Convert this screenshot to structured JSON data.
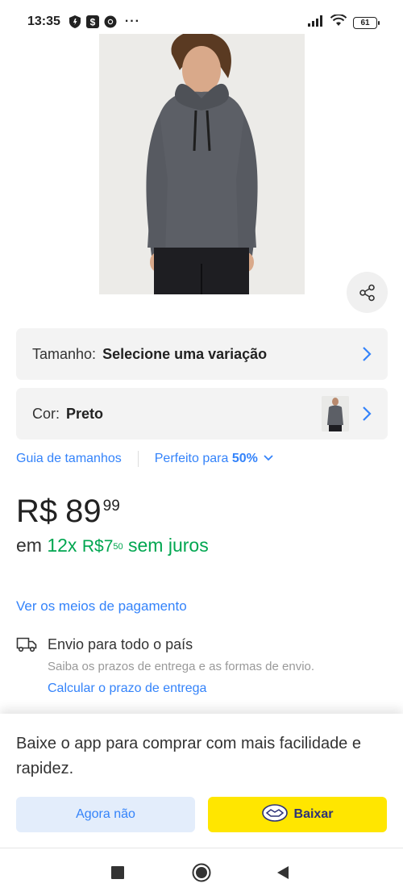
{
  "status_bar": {
    "time": "13:35",
    "dots": "···",
    "battery": "61"
  },
  "product": {
    "image_alt": "Homem vestindo blusa de moletom cinza com capuz"
  },
  "variations": {
    "size_label": "Tamanho:",
    "size_value": "Selecione uma variação",
    "color_label": "Cor:",
    "color_value": "Preto"
  },
  "guide": {
    "size_guide": "Guia de tamanhos",
    "fit_prefix": "Perfeito para",
    "fit_percent": "50%"
  },
  "price": {
    "currency": "R$",
    "integer": "89",
    "cents": "99"
  },
  "installments": {
    "prefix": "em",
    "count": "12x",
    "currency": "R$",
    "integer": "7",
    "cents": "50",
    "suffix": "sem juros"
  },
  "payment_link": "Ver os meios de pagamento",
  "shipping": {
    "title": "Envio para todo o país",
    "subtitle": "Saiba os prazos de entrega e as formas de envio.",
    "link": "Calcular o prazo de entrega"
  },
  "app_sheet": {
    "message": "Baixe o app para comprar com mais facilidade e rapidez.",
    "later_label": "Agora não",
    "download_label": "Baixar"
  },
  "colors": {
    "link": "#3483fa",
    "green": "#00a650",
    "yellow": "#ffe600",
    "navy": "#2d3277"
  }
}
